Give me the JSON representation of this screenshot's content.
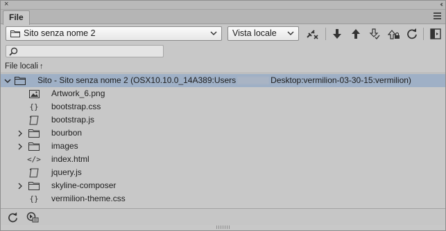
{
  "panel": {
    "close_glyph": "×",
    "collapse_glyph": "‹‹",
    "tab_label": "File",
    "menu_icon": "hamburger-menu-icon"
  },
  "toolbar": {
    "site_select_value": "Sito senza nome 2",
    "view_select_value": "Vista locale",
    "icons": [
      "connect-icon",
      "get-icon",
      "put-icon",
      "check-out-icon",
      "check-in-icon",
      "refresh-icon",
      "expand-icon"
    ]
  },
  "search": {
    "placeholder": "",
    "icon": "search-icon"
  },
  "column_header": {
    "label": "File locali",
    "sort_glyph": "↑"
  },
  "tree": {
    "root": {
      "label_start": "Sito - Sito senza nome 2 (OSX10.10.0_14A389:Users",
      "label_end": "Desktop:vermilion-03-30-15:vermilion)",
      "expanded": true
    },
    "items": [
      {
        "label": "Artwork_6.png",
        "icon": "image-icon",
        "icon_glyph": "",
        "expandable": false
      },
      {
        "label": "bootstrap.css",
        "icon": "css-icon",
        "icon_glyph": "{}",
        "expandable": false
      },
      {
        "label": "bootstrap.js",
        "icon": "script-icon",
        "icon_glyph": "",
        "expandable": false
      },
      {
        "label": "bourbon",
        "icon": "folder-icon",
        "icon_glyph": "",
        "expandable": true
      },
      {
        "label": "images",
        "icon": "folder-icon",
        "icon_glyph": "",
        "expandable": true
      },
      {
        "label": "index.html",
        "icon": "html-icon",
        "icon_glyph": "</>",
        "expandable": false
      },
      {
        "label": "jquery.js",
        "icon": "script-icon",
        "icon_glyph": "",
        "expandable": false
      },
      {
        "label": "skyline-composer",
        "icon": "folder-icon",
        "icon_glyph": "",
        "expandable": true
      },
      {
        "label": "vermilion-theme.css",
        "icon": "css-icon",
        "icon_glyph": "{}",
        "expandable": false
      }
    ]
  },
  "bottombar": {
    "icons": [
      "refresh-icon",
      "log-icon"
    ]
  },
  "colors": {
    "panel_bg": "#c8c8c8",
    "selection": "#9fb0c6",
    "icon": "#333333"
  }
}
